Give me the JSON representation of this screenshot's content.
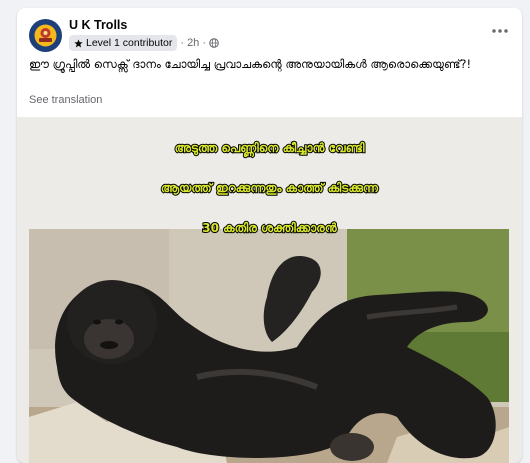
{
  "post": {
    "author": "U K Trolls",
    "badge": "Level 1 contributor",
    "time": "2h",
    "separator": "·",
    "text": "ഈ ഗ്രൂപ്പിൽ സെക്സ് ദാനം ചോയിച്ച പ്രവാചകന്റെ അനുയായികൾ ആരൊക്കെയുണ്ട്?!",
    "see_translation": "See translation"
  },
  "meme": {
    "line1": "അടുത്ത പെണ്ണിനെ കീച്ചാൻ വേണ്ടി",
    "line2": "ആയത്ത് ഇറക്കുന്നതും കാത്ത് കിടക്കുന്ന",
    "line3": "30 കതിര ശക്തിക്കാരൻ"
  },
  "colors": {
    "meme_text": "#d9e82c",
    "meme_outline": "#000000",
    "badge_bg": "#e4e6eb",
    "avatar_bg": "#1d3f7a"
  },
  "icons": {
    "badge": "star-badge-icon",
    "audience": "globe-icon",
    "more": "more-options-icon"
  }
}
